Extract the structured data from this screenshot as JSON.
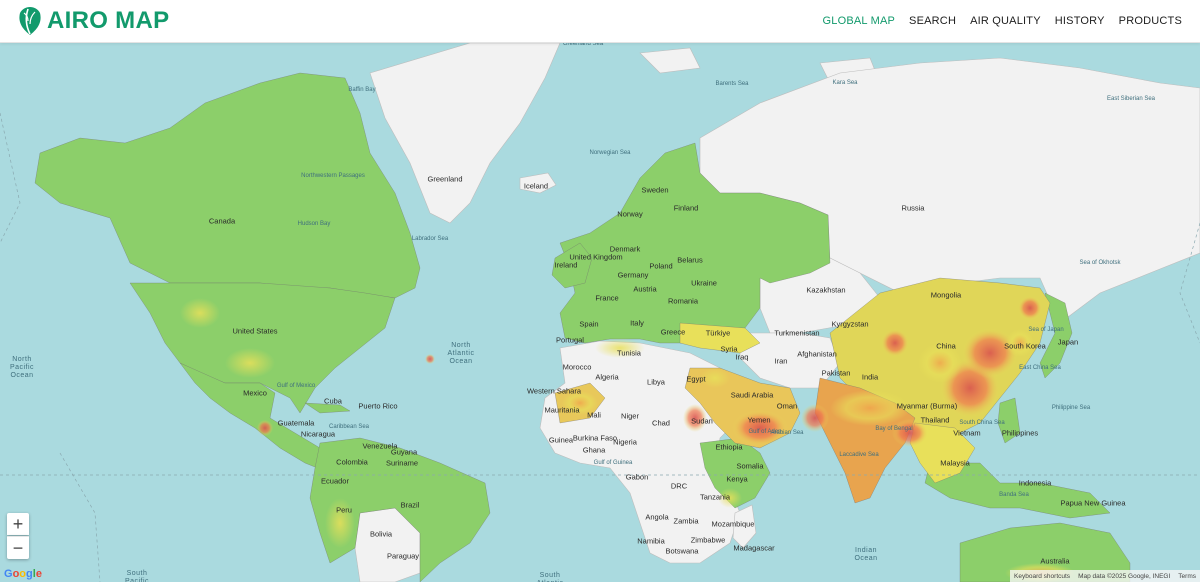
{
  "app": {
    "name": "AIRO MAP"
  },
  "nav": [
    {
      "label": "GLOBAL MAP",
      "active": true
    },
    {
      "label": "SEARCH",
      "active": false
    },
    {
      "label": "AIR QUALITY",
      "active": false
    },
    {
      "label": "HISTORY",
      "active": false
    },
    {
      "label": "PRODUCTS",
      "active": false
    }
  ],
  "colors": {
    "brand": "#129a6c",
    "ocean": "#aadadf",
    "land_unknown": "#f2f2f2",
    "aqi_good": "#8ccf6a",
    "aqi_moderate": "#e8e05a",
    "aqi_unhealthy": "#f07a50",
    "aqi_very_unhealthy": "#d9534f"
  },
  "map": {
    "zoom_in": "+",
    "zoom_out": "−",
    "google_logo": "Google",
    "attribution": {
      "shortcuts": "Keyboard shortcuts",
      "data": "Map data ©2025 Google, INEGI",
      "terms": "Terms"
    },
    "labels": [
      {
        "name": "Greenland Sea",
        "kind": "sea"
      },
      {
        "name": "Baffin Bay",
        "kind": "sea"
      },
      {
        "name": "Barents Sea",
        "kind": "sea"
      },
      {
        "name": "Kara Sea",
        "kind": "sea"
      },
      {
        "name": "East Siberian Sea",
        "kind": "sea"
      },
      {
        "name": "Norwegian Sea",
        "kind": "sea"
      },
      {
        "name": "Northwestern Passages",
        "kind": "sea"
      },
      {
        "name": "Hudson Bay",
        "kind": "sea"
      },
      {
        "name": "Labrador Sea",
        "kind": "sea"
      },
      {
        "name": "Greenland",
        "kind": "country"
      },
      {
        "name": "Iceland",
        "kind": "country"
      },
      {
        "name": "Canada",
        "kind": "country"
      },
      {
        "name": "Russia",
        "kind": "country"
      },
      {
        "name": "Sweden",
        "kind": "country"
      },
      {
        "name": "Norway",
        "kind": "country"
      },
      {
        "name": "Finland",
        "kind": "country"
      },
      {
        "name": "United Kingdom",
        "kind": "country"
      },
      {
        "name": "Ireland",
        "kind": "country"
      },
      {
        "name": "Denmark",
        "kind": "country"
      },
      {
        "name": "Belarus",
        "kind": "country"
      },
      {
        "name": "Poland",
        "kind": "country"
      },
      {
        "name": "Germany",
        "kind": "country"
      },
      {
        "name": "Ukraine",
        "kind": "country"
      },
      {
        "name": "France",
        "kind": "country"
      },
      {
        "name": "Austria",
        "kind": "country"
      },
      {
        "name": "Romania",
        "kind": "country"
      },
      {
        "name": "Spain",
        "kind": "country"
      },
      {
        "name": "Portugal",
        "kind": "country"
      },
      {
        "name": "Italy",
        "kind": "country"
      },
      {
        "name": "Greece",
        "kind": "country"
      },
      {
        "name": "Türkiye",
        "kind": "country"
      },
      {
        "name": "Kazakhstan",
        "kind": "country"
      },
      {
        "name": "Mongolia",
        "kind": "country"
      },
      {
        "name": "Turkmenistan",
        "kind": "country"
      },
      {
        "name": "Kyrgyzstan",
        "kind": "country"
      },
      {
        "name": "Afghanistan",
        "kind": "country"
      },
      {
        "name": "Syria",
        "kind": "country"
      },
      {
        "name": "Iraq",
        "kind": "country"
      },
      {
        "name": "Iran",
        "kind": "country"
      },
      {
        "name": "Pakistan",
        "kind": "country"
      },
      {
        "name": "China",
        "kind": "country"
      },
      {
        "name": "South Korea",
        "kind": "country"
      },
      {
        "name": "Japan",
        "kind": "country"
      },
      {
        "name": "Sea of Japan",
        "kind": "sea"
      },
      {
        "name": "East China Sea",
        "kind": "sea"
      },
      {
        "name": "Sea of Okhotsk",
        "kind": "sea"
      },
      {
        "name": "India",
        "kind": "country"
      },
      {
        "name": "Myanmar (Burma)",
        "kind": "country"
      },
      {
        "name": "Thailand",
        "kind": "country"
      },
      {
        "name": "Vietnam",
        "kind": "country"
      },
      {
        "name": "Philippines",
        "kind": "country"
      },
      {
        "name": "Philippine Sea",
        "kind": "sea"
      },
      {
        "name": "South China Sea",
        "kind": "sea"
      },
      {
        "name": "Bay of Bengal",
        "kind": "sea"
      },
      {
        "name": "Arabian Sea",
        "kind": "sea"
      },
      {
        "name": "Laccadive Sea",
        "kind": "sea"
      },
      {
        "name": "Malaysia",
        "kind": "country"
      },
      {
        "name": "Indonesia",
        "kind": "country"
      },
      {
        "name": "Banda Sea",
        "kind": "sea"
      },
      {
        "name": "Papua New Guinea",
        "kind": "country"
      },
      {
        "name": "Australia",
        "kind": "country"
      },
      {
        "name": "United States",
        "kind": "country"
      },
      {
        "name": "Mexico",
        "kind": "country"
      },
      {
        "name": "Gulf of Mexico",
        "kind": "sea"
      },
      {
        "name": "Cuba",
        "kind": "country"
      },
      {
        "name": "Puerto Rico",
        "kind": "country"
      },
      {
        "name": "Guatemala",
        "kind": "country"
      },
      {
        "name": "Nicaragua",
        "kind": "country"
      },
      {
        "name": "Caribbean Sea",
        "kind": "sea"
      },
      {
        "name": "Venezuela",
        "kind": "country"
      },
      {
        "name": "Guyana",
        "kind": "country"
      },
      {
        "name": "Suriname",
        "kind": "country"
      },
      {
        "name": "Colombia",
        "kind": "country"
      },
      {
        "name": "Ecuador",
        "kind": "country"
      },
      {
        "name": "Peru",
        "kind": "country"
      },
      {
        "name": "Brazil",
        "kind": "country"
      },
      {
        "name": "Bolivia",
        "kind": "country"
      },
      {
        "name": "Paraguay",
        "kind": "country"
      },
      {
        "name": "North\nAtlantic\nOcean",
        "kind": "ocean"
      },
      {
        "name": "North\nPacific\nOcean",
        "kind": "ocean"
      },
      {
        "name": "South\nAtlantic",
        "kind": "ocean"
      },
      {
        "name": "South\nPacific",
        "kind": "ocean"
      },
      {
        "name": "Indian\nOcean",
        "kind": "ocean"
      },
      {
        "name": "Morocco",
        "kind": "country"
      },
      {
        "name": "Tunisia",
        "kind": "country"
      },
      {
        "name": "Algeria",
        "kind": "country"
      },
      {
        "name": "Libya",
        "kind": "country"
      },
      {
        "name": "Egypt",
        "kind": "country"
      },
      {
        "name": "Western Sahara",
        "kind": "country"
      },
      {
        "name": "Mauritania",
        "kind": "country"
      },
      {
        "name": "Mali",
        "kind": "country"
      },
      {
        "name": "Niger",
        "kind": "country"
      },
      {
        "name": "Chad",
        "kind": "country"
      },
      {
        "name": "Sudan",
        "kind": "country"
      },
      {
        "name": "Saudi Arabia",
        "kind": "country"
      },
      {
        "name": "Oman",
        "kind": "country"
      },
      {
        "name": "Yemen",
        "kind": "country"
      },
      {
        "name": "Gulf of Aden",
        "kind": "sea"
      },
      {
        "name": "Ethiopia",
        "kind": "country"
      },
      {
        "name": "Somalia",
        "kind": "country"
      },
      {
        "name": "Kenya",
        "kind": "country"
      },
      {
        "name": "Guinea",
        "kind": "country"
      },
      {
        "name": "Burkina Faso",
        "kind": "country"
      },
      {
        "name": "Ghana",
        "kind": "country"
      },
      {
        "name": "Nigeria",
        "kind": "country"
      },
      {
        "name": "Gulf of Guinea",
        "kind": "sea"
      },
      {
        "name": "Gabon",
        "kind": "country"
      },
      {
        "name": "DRC",
        "kind": "country"
      },
      {
        "name": "Tanzania",
        "kind": "country"
      },
      {
        "name": "Angola",
        "kind": "country"
      },
      {
        "name": "Zambia",
        "kind": "country"
      },
      {
        "name": "Mozambique",
        "kind": "country"
      },
      {
        "name": "Namibia",
        "kind": "country"
      },
      {
        "name": "Botswana",
        "kind": "country"
      },
      {
        "name": "Zimbabwe",
        "kind": "country"
      },
      {
        "name": "Madagascar",
        "kind": "country"
      }
    ]
  }
}
